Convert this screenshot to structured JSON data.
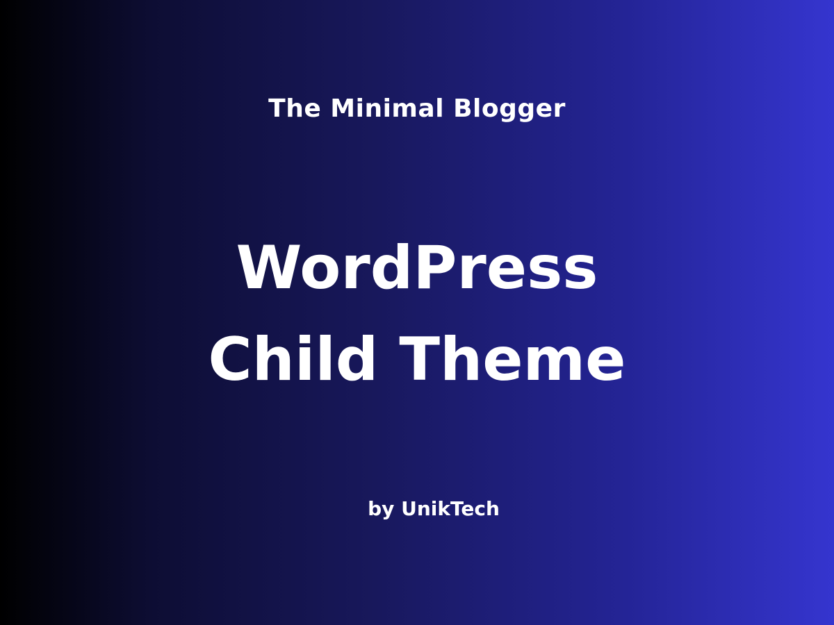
{
  "banner": {
    "subtitle": "The Minimal Blogger",
    "headline_line1": "WordPress",
    "headline_line2": "Child Theme",
    "byline": "by UnikTech"
  },
  "colors": {
    "text": "#ffffff",
    "gradient_start": "#000000",
    "gradient_mid": "#18185c",
    "gradient_end": "#3535cf"
  }
}
